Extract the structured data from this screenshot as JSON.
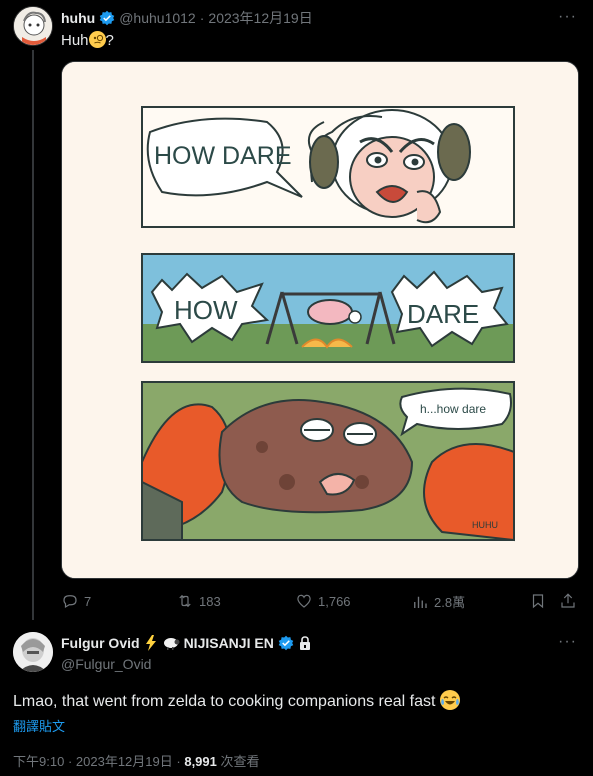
{
  "post1": {
    "author_name": "huhu",
    "handle": "@huhu1012",
    "separator": "·",
    "date": "2023年12月19日",
    "text": "Huh",
    "text_suffix": "?",
    "more": "···",
    "comic": {
      "panel1_bubble": "HOW DARE",
      "panel2_left": "HOW",
      "panel2_right": "DARE",
      "panel3_bubble": "h...how dare",
      "signature": "HUHU"
    },
    "actions": {
      "replies": "7",
      "reposts": "183",
      "likes": "1,766",
      "views": "2.8萬"
    }
  },
  "post2": {
    "author_name": "Fulgur Ovid",
    "author_suffix": "NIJISANJI EN",
    "handle": "@Fulgur_Ovid",
    "more": "···",
    "text": "Lmao, that went from zelda to cooking companions real fast",
    "translate": "翻譯貼文",
    "time": "下午9:10",
    "separator": "·",
    "date": "2023年12月19日",
    "views_count": "8,991",
    "views_label": "次查看"
  },
  "colors": {
    "background": "#000000",
    "text_primary": "#e7e9ea",
    "text_secondary": "#71767b",
    "accent": "#1d9bf0"
  },
  "icons": [
    "verified-badge-icon",
    "reply-icon",
    "repost-icon",
    "like-icon",
    "views-icon",
    "bookmark-icon",
    "share-icon",
    "lock-icon",
    "lightning-icon",
    "sheep-icon"
  ]
}
